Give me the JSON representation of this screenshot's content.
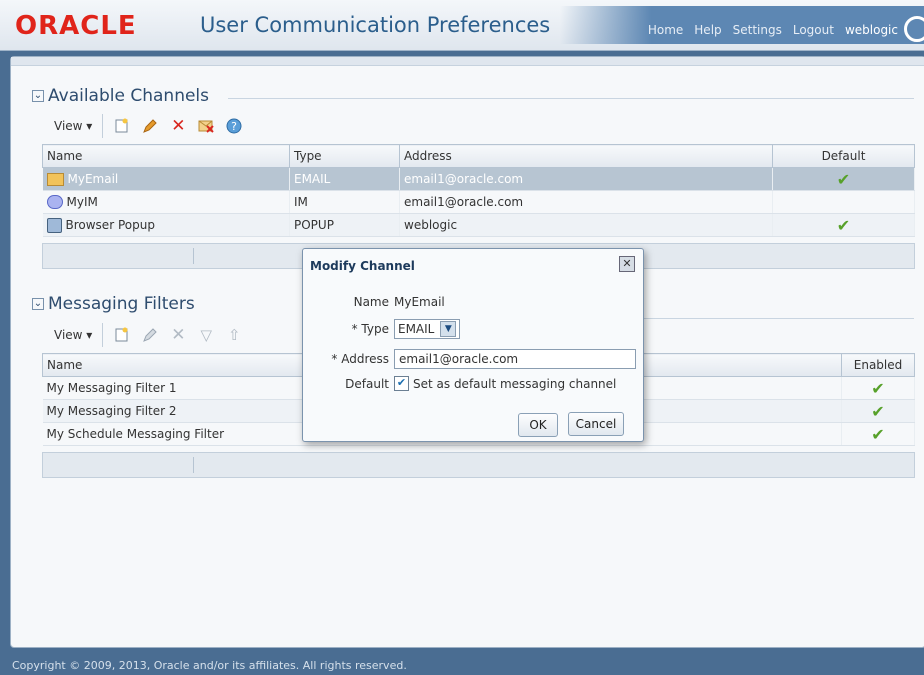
{
  "header": {
    "logo": "ORACLE",
    "title": "User Communication Preferences"
  },
  "nav": {
    "home": "Home",
    "help": "Help",
    "settings": "Settings",
    "logout": "Logout",
    "user": "weblogic"
  },
  "channels": {
    "title": "Available Channels",
    "toolbar": {
      "view": "View ▾"
    },
    "columns": [
      "Name",
      "Type",
      "Address",
      "Default"
    ],
    "rows": [
      {
        "name": "MyEmail",
        "type": "EMAIL",
        "address": "email1@oracle.com",
        "default": true
      },
      {
        "name": "MyIM",
        "type": "IM",
        "address": "email1@oracle.com",
        "default": false
      },
      {
        "name": "Browser Popup",
        "type": "POPUP",
        "address": "weblogic",
        "default": true
      }
    ]
  },
  "filters": {
    "title": "Messaging Filters",
    "toolbar": {
      "view": "View ▾"
    },
    "columns": [
      "Name",
      "Enabled"
    ],
    "rows": [
      {
        "name": "My Messaging Filter 1",
        "enabled": true
      },
      {
        "name": "My Messaging Filter 2",
        "enabled": true
      },
      {
        "name": "My Schedule Messaging Filter",
        "enabled": true
      }
    ]
  },
  "dialog": {
    "title": "Modify Channel",
    "name_label": "Name",
    "name_value": "MyEmail",
    "type_label": "* Type",
    "type_value": "EMAIL",
    "address_label": "* Address",
    "address_value": "email1@oracle.com",
    "default_label": "Default",
    "default_checkbox_label": "Set as default messaging channel",
    "ok": "OK",
    "cancel": "Cancel"
  },
  "footer": {
    "copyright": "Copyright © 2009, 2013, Oracle and/or its affiliates. All rights reserved."
  },
  "colors": {
    "brand": "#e0241a",
    "title": "#2b5e8c",
    "check": "#57a12a",
    "header_bar": "#5d87b3"
  }
}
